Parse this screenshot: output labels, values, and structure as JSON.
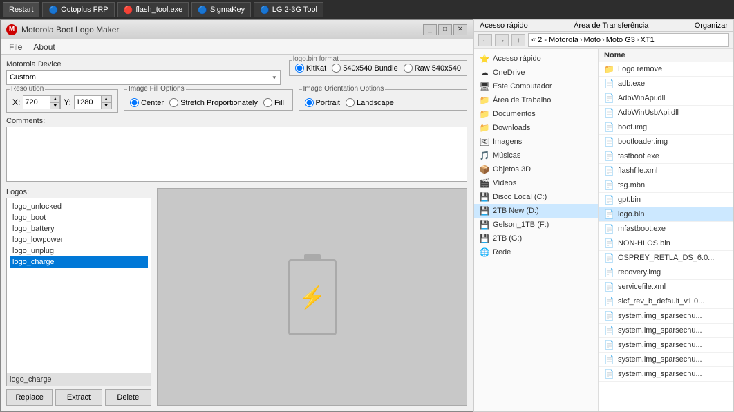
{
  "taskbar": {
    "restart_label": "Restart",
    "apps": [
      {
        "name": "OctoFRP",
        "label": "Octoplus FRP",
        "icon": "🔵"
      },
      {
        "name": "FlashTool",
        "label": "flash_tool.exe",
        "icon": "🔴"
      },
      {
        "name": "SigmaKey",
        "label": "SigmaKey",
        "icon": "🔵"
      },
      {
        "name": "LG2G",
        "label": "LG 2-3G Tool",
        "icon": "🔵"
      }
    ]
  },
  "moto_window": {
    "title": "Motorola Boot Logo Maker",
    "menu": [
      "File",
      "About"
    ],
    "device_label": "Motorola Device",
    "device_value": "Custom",
    "format_label": "logo.bin format",
    "format_options": [
      "KitKat",
      "540x540 Bundle",
      "Raw 540x540"
    ],
    "format_selected": "KitKat",
    "resolution_label": "Resolution",
    "x_label": "X:",
    "x_value": "720",
    "y_label": "Y:",
    "y_value": "1280",
    "fill_options_label": "Image Fill Options",
    "fill_options": [
      "Center",
      "Stretch Proportionately",
      "Fill"
    ],
    "fill_selected": "Center",
    "orientation_label": "Image Orientation Options",
    "orientation_options": [
      "Portrait",
      "Landscape"
    ],
    "orientation_selected": "Portrait",
    "comments_label": "Comments:",
    "logos_label": "Logos:",
    "logo_items": [
      "logo_unlocked",
      "logo_boot",
      "logo_battery",
      "logo_lowpower",
      "logo_unplug",
      "logo_charge"
    ],
    "selected_logo": "logo_charge",
    "btn_replace": "Replace",
    "btn_extract": "Extract",
    "btn_delete": "Delete"
  },
  "explorer": {
    "quick_access_label": "Acesso rápido",
    "clipboard_label": "Área de Transferência",
    "organize_label": "Organizar",
    "nav_back": "←",
    "nav_forward": "→",
    "nav_up": "↑",
    "breadcrumb": [
      "« 2 - Motorola",
      "Moto",
      "Moto G3",
      "XT1"
    ],
    "column_name": "Nome",
    "sidebar_items": [
      {
        "label": "Acesso rápido",
        "type": "special",
        "icon": "⭐"
      },
      {
        "label": "OneDrive",
        "type": "cloud",
        "icon": "☁"
      },
      {
        "label": "Este Computador",
        "type": "computer",
        "icon": "🖥"
      },
      {
        "label": "Área de Trabalho",
        "type": "folder",
        "icon": "📁"
      },
      {
        "label": "Documentos",
        "type": "folder",
        "icon": "📁"
      },
      {
        "label": "Downloads",
        "type": "folder",
        "icon": "📁"
      },
      {
        "label": "Imagens",
        "type": "folder",
        "icon": "🖼"
      },
      {
        "label": "Músicas",
        "type": "folder",
        "icon": "🎵"
      },
      {
        "label": "Objetos 3D",
        "type": "folder",
        "icon": "📦"
      },
      {
        "label": "Vídeos",
        "type": "folder",
        "icon": "🎬"
      },
      {
        "label": "Disco Local (C:)",
        "type": "drive",
        "icon": "💾"
      },
      {
        "label": "2TB New (D:)",
        "type": "drive",
        "icon": "💾",
        "selected": true
      },
      {
        "label": "Gelson_1TB (F:)",
        "type": "drive",
        "icon": "💾"
      },
      {
        "label": "2TB (G:)",
        "type": "drive",
        "icon": "💾"
      },
      {
        "label": "Rede",
        "type": "network",
        "icon": "🌐"
      }
    ],
    "files": [
      {
        "name": "Logo remove",
        "type": "folder",
        "icon": "folder"
      },
      {
        "name": "adb.exe",
        "type": "file",
        "icon": "file"
      },
      {
        "name": "AdbWinApi.dll",
        "type": "file",
        "icon": "file"
      },
      {
        "name": "AdbWinUsbApi.dll",
        "type": "file",
        "icon": "file"
      },
      {
        "name": "boot.img",
        "type": "file",
        "icon": "file"
      },
      {
        "name": "bootloader.img",
        "type": "file",
        "icon": "file"
      },
      {
        "name": "fastboot.exe",
        "type": "file",
        "icon": "file"
      },
      {
        "name": "flashfile.xml",
        "type": "file",
        "icon": "file"
      },
      {
        "name": "fsg.mbn",
        "type": "file",
        "icon": "file"
      },
      {
        "name": "gpt.bin",
        "type": "file",
        "icon": "file"
      },
      {
        "name": "logo.bin",
        "type": "file",
        "icon": "file",
        "selected": true
      },
      {
        "name": "mfastboot.exe",
        "type": "file",
        "icon": "file"
      },
      {
        "name": "NON-HLOS.bin",
        "type": "file",
        "icon": "file"
      },
      {
        "name": "OSPREY_RETLA_DS_6.0...",
        "type": "file",
        "icon": "file"
      },
      {
        "name": "recovery.img",
        "type": "file",
        "icon": "file"
      },
      {
        "name": "servicefile.xml",
        "type": "file",
        "icon": "file"
      },
      {
        "name": "slcf_rev_b_default_v1.0...",
        "type": "file",
        "icon": "file"
      },
      {
        "name": "system.img_sparsechu...",
        "type": "file",
        "icon": "file"
      },
      {
        "name": "system.img_sparsechu...",
        "type": "file",
        "icon": "file"
      },
      {
        "name": "system.img_sparsechu...",
        "type": "file",
        "icon": "file"
      },
      {
        "name": "system.img_sparsechu...",
        "type": "file",
        "icon": "file"
      },
      {
        "name": "system.img_sparsechu...",
        "type": "file",
        "icon": "file"
      }
    ]
  }
}
